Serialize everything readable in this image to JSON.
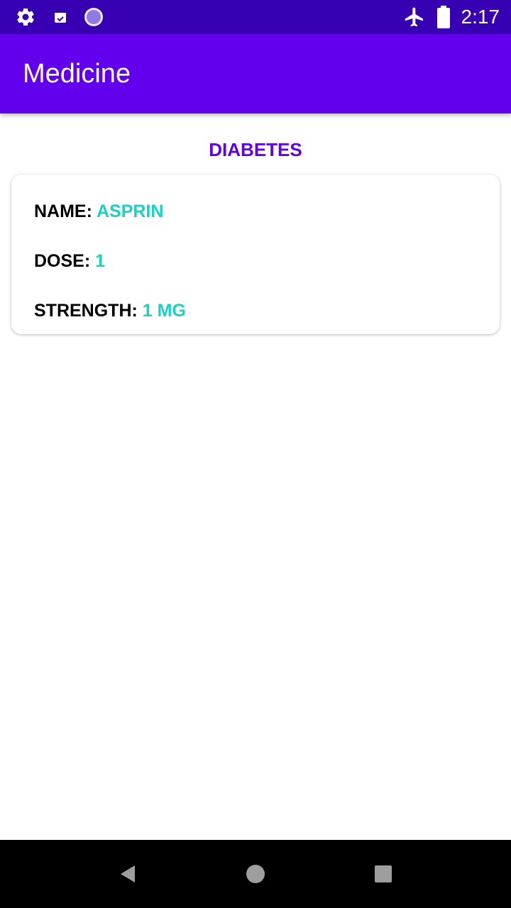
{
  "status_bar": {
    "time": "2:17",
    "left_icons": [
      "gear-icon",
      "calendar-check-icon",
      "sync-circle-icon"
    ],
    "right_icons": [
      "airplane-mode-icon",
      "battery-icon"
    ]
  },
  "app_bar": {
    "title": "Medicine"
  },
  "category": {
    "title": "DIABETES"
  },
  "medicine_card": {
    "name_label": "NAME:",
    "name_value": "ASPRIN",
    "dose_label": "DOSE:",
    "dose_value": "1",
    "strength_label": "STRENGTH:",
    "strength_value": "1 MG"
  },
  "nav_bar": {
    "buttons": [
      "back-icon",
      "home-icon",
      "recents-icon"
    ]
  },
  "colors": {
    "status_bar": "#3700b3",
    "app_bar": "#6200ee",
    "accent_purple": "#6200ee",
    "value_teal": "#1ad1c6",
    "nav_bar": "#000000"
  }
}
